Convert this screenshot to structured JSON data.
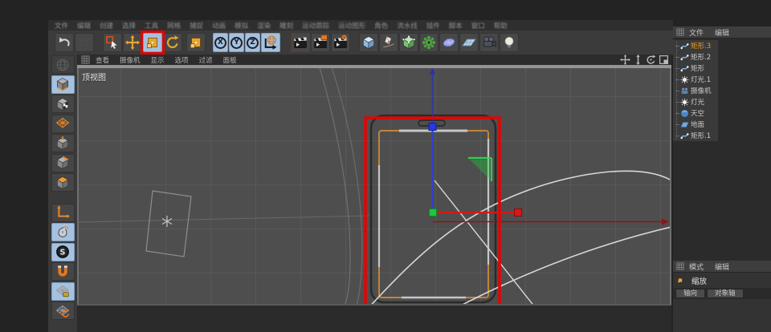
{
  "colors": {
    "annotation_red": "#e00505",
    "axis_x_red": "#d81818",
    "axis_y_blue": "#2f3fd8",
    "gizmo_green": "#1cc838",
    "spline_orange": "#c08437",
    "active_tile_blue": "#a4c2e0",
    "selected_object_orange": "#e89c28",
    "viewport_bg": "#4e4e4e"
  },
  "menu_bar": {
    "items": [
      "文件",
      "编辑",
      "创建",
      "选择",
      "工具",
      "网格",
      "捕捉",
      "动画",
      "模拟",
      "渲染",
      "雕刻",
      "运动跟踪",
      "运动图形",
      "角色",
      "流水线",
      "插件",
      "脚本",
      "窗口",
      "帮助"
    ]
  },
  "toolbar": {
    "groups": [
      {
        "buttons": [
          {
            "name": "undo",
            "icon": "undo-icon"
          },
          {
            "name": "redo",
            "icon": "redo-icon",
            "disabled": true
          }
        ]
      },
      {
        "buttons": [
          {
            "name": "live-selection",
            "icon": "live-selection-icon"
          },
          {
            "name": "move",
            "icon": "move-icon"
          },
          {
            "name": "scale",
            "icon": "scale-icon",
            "active": true,
            "annotated": true
          },
          {
            "name": "rotate",
            "icon": "rotate-icon"
          }
        ]
      },
      {
        "buttons": [
          {
            "name": "last-used-tool",
            "icon": "scale-icon"
          }
        ]
      },
      {
        "buttons": [
          {
            "name": "lock-x-axis",
            "label": "X",
            "active": true
          },
          {
            "name": "lock-y-axis",
            "label": "Y",
            "active": true
          },
          {
            "name": "lock-z-axis",
            "label": "Z",
            "active": true
          },
          {
            "name": "coordinate-system",
            "icon": "coordinate-globe-icon",
            "active": true
          }
        ]
      },
      {
        "buttons": [
          {
            "name": "render-view",
            "icon": "render-view-icon",
            "framed": true
          },
          {
            "name": "render-to-picture-viewer",
            "icon": "render-picture-icon"
          },
          {
            "name": "render-settings",
            "icon": "render-settings-icon"
          }
        ]
      },
      {
        "buttons": [
          {
            "name": "add-cube",
            "icon": "cube-tool-icon"
          },
          {
            "name": "spline-pen",
            "icon": "pen-tool-icon"
          },
          {
            "name": "subdivision-surface",
            "icon": "subdivision-icon"
          },
          {
            "name": "modeling-tools",
            "icon": "modeling-icon"
          },
          {
            "name": "deformer",
            "icon": "deformer-icon"
          },
          {
            "name": "floor",
            "icon": "floor-tool-icon"
          },
          {
            "name": "camera",
            "icon": "camera-tool-icon"
          },
          {
            "name": "light",
            "icon": "light-tool-icon"
          }
        ]
      }
    ]
  },
  "sidebar": {
    "items": [
      {
        "name": "make-editable",
        "icon": "make-editable-icon",
        "disabled": true
      },
      {
        "name": "model-mode",
        "icon": "model-mode-icon",
        "active": true
      },
      {
        "name": "texture-mode",
        "icon": "texture-mode-icon"
      },
      {
        "name": "workplane-mode",
        "icon": "workplane-mode-icon"
      },
      {
        "name": "points-mode",
        "icon": "points-mode-icon"
      },
      {
        "name": "edges-mode",
        "icon": "edges-mode-icon"
      },
      {
        "name": "polygons-mode",
        "icon": "polygons-mode-icon"
      },
      {
        "name": "enable-axis",
        "icon": "enable-axis-icon",
        "gap": true
      },
      {
        "name": "viewport-solo",
        "icon": "viewport-solo-icon",
        "active": true
      },
      {
        "name": "snap",
        "icon": "snap-icon",
        "active": true
      },
      {
        "name": "magnet",
        "icon": "magnet-icon"
      },
      {
        "name": "lock-workplane",
        "icon": "lock-workplane-icon",
        "active": true
      },
      {
        "name": "workplane",
        "icon": "workplane-icon"
      }
    ]
  },
  "viewport": {
    "menu": [
      "查看",
      "摄像机",
      "显示",
      "选项",
      "过滤",
      "面板"
    ],
    "view_label": "顶视图",
    "nav": [
      "pan-icon",
      "dolly-icon",
      "rotate-view-icon",
      "toggle-view-icon"
    ]
  },
  "object_manager": {
    "menu": [
      "文件",
      "编辑"
    ],
    "objects": [
      {
        "label": "矩形.3",
        "icon": "spline-object-icon",
        "selected": true
      },
      {
        "label": "矩形.2",
        "icon": "spline-object-icon"
      },
      {
        "label": "矩形",
        "icon": "spline-object-icon"
      },
      {
        "label": "灯光.1",
        "icon": "light-object-icon"
      },
      {
        "label": "摄像机",
        "icon": "camera-object-icon"
      },
      {
        "label": "灯光",
        "icon": "light-object-icon"
      },
      {
        "label": "天空",
        "icon": "sky-object-icon"
      },
      {
        "label": "地面",
        "icon": "floor-object-icon"
      },
      {
        "label": "矩形.1",
        "icon": "spline-object-icon"
      }
    ]
  },
  "attribute_manager": {
    "menu": [
      "模式",
      "编辑"
    ],
    "tool": {
      "label": "缩放",
      "icon": "scale-icon"
    },
    "tabs": [
      "轴向",
      "对象轴"
    ]
  }
}
